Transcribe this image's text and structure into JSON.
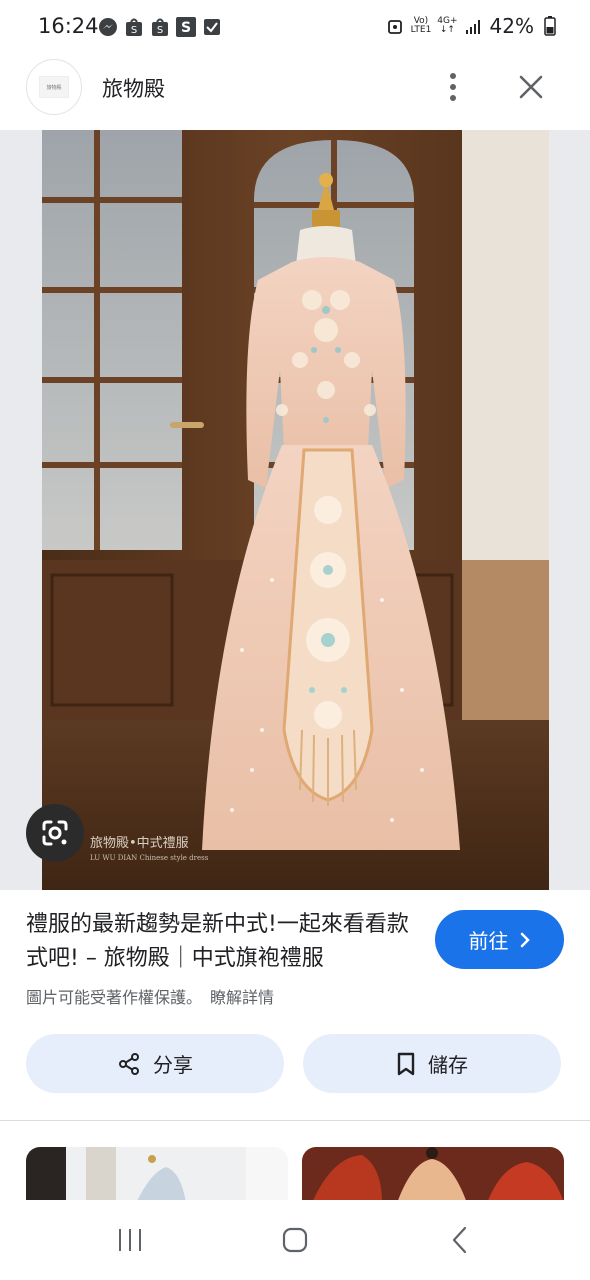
{
  "status_bar": {
    "time": "16:24",
    "battery_percent": "42%",
    "network": "LTE1",
    "network_top": "Vo)",
    "network_gen": "4G+",
    "left_icons": [
      "messenger-icon",
      "shopee-icon",
      "shopee-icon",
      "s-app-icon",
      "checkbox-icon"
    ]
  },
  "header": {
    "site_name": "旅物殿",
    "avatar_text": "旅物殿"
  },
  "image": {
    "description_icon": "lens-icon"
  },
  "result": {
    "title": "禮服的最新趨勢是新中式!一起來看看款式吧! – 旅物殿｜中式旗袍禮服",
    "visit_label": "前往",
    "copyright_text": "圖片可能受著作權保護。",
    "learn_more": "瞭解詳情"
  },
  "actions": {
    "share_label": "分享",
    "save_label": "儲存"
  },
  "colors": {
    "accent": "#1a73e8",
    "action_bg": "#e7eefb"
  }
}
